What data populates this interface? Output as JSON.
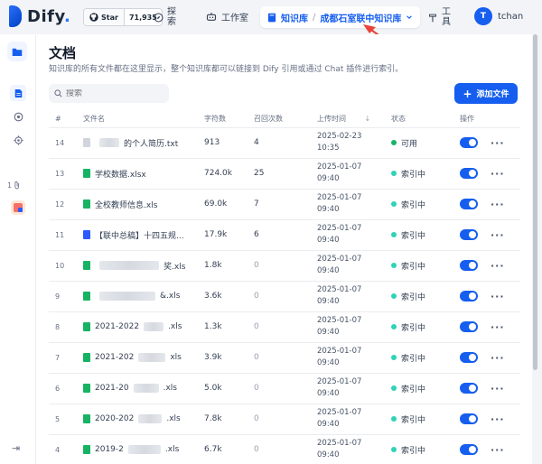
{
  "app": {
    "name": "Dify",
    "name_suffix": "."
  },
  "github": {
    "star_label": "Star",
    "star_count": "71,935"
  },
  "nav": {
    "explore": "探索",
    "studio": "工作室",
    "knowledge": "知识库",
    "dataset_name": "成都石室联中知识库",
    "tools": "工具"
  },
  "user": {
    "initial": "T",
    "name": "tchan"
  },
  "rail": {
    "attach_count": "1"
  },
  "page": {
    "title": "文档",
    "description": "知识库的所有文件都在这里显示，整个知识库都可以链接到 Dify 引用或通过 Chat 插件进行索引。",
    "search_placeholder": "搜索",
    "add_button": "添加文件"
  },
  "table": {
    "headers": {
      "index": "#",
      "name": "文件名",
      "chars": "字符数",
      "hits": "召回次数",
      "uploaded": "上传时间",
      "status": "状态",
      "actions": "操作"
    },
    "rows": [
      {
        "index": "14",
        "icon": "txt",
        "blur_w": 22,
        "prefix": "",
        "suffix": "的个人简历.txt",
        "chars": "913",
        "hits": "4",
        "date": "2025-02-23",
        "time": "10:35",
        "status": "可用",
        "status_type": "ok"
      },
      {
        "index": "13",
        "icon": "xls",
        "blur_w": 0,
        "prefix": "学校数据.xlsx",
        "suffix": "",
        "chars": "724.0k",
        "hits": "25",
        "date": "2025-01-07",
        "time": "09:40",
        "status": "索引中",
        "status_type": "idx"
      },
      {
        "index": "12",
        "icon": "xls",
        "blur_w": 0,
        "prefix": "全校教师信息.xls",
        "suffix": "",
        "chars": "69.0k",
        "hits": "7",
        "date": "2025-01-07",
        "time": "09:40",
        "status": "索引中",
        "status_type": "idx"
      },
      {
        "index": "11",
        "icon": "doc",
        "blur_w": 0,
        "prefix": "【联中总稿】十四五规...",
        "suffix": "",
        "chars": "17.9k",
        "hits": "6",
        "date": "2025-01-07",
        "time": "09:40",
        "status": "索引中",
        "status_type": "idx"
      },
      {
        "index": "10",
        "icon": "xls",
        "blur_w": 66,
        "prefix": "",
        "suffix": "奖.xls",
        "chars": "1.8k",
        "hits": "0",
        "date": "2025-01-07",
        "time": "09:40",
        "status": "索引中",
        "status_type": "idx"
      },
      {
        "index": "9",
        "icon": "xls",
        "blur_w": 62,
        "prefix": "",
        "suffix": "&.xls",
        "chars": "3.6k",
        "hits": "0",
        "date": "2025-01-07",
        "time": "09:40",
        "status": "索引中",
        "status_type": "idx"
      },
      {
        "index": "8",
        "icon": "xls",
        "blur_w": 22,
        "prefix": "2021-2022",
        "suffix": ".xls",
        "chars": "1.3k",
        "hits": "0",
        "date": "2025-01-07",
        "time": "09:40",
        "status": "索引中",
        "status_type": "idx"
      },
      {
        "index": "7",
        "icon": "xls",
        "blur_w": 30,
        "prefix": "2021-202",
        "suffix": "xls",
        "chars": "3.9k",
        "hits": "0",
        "date": "2025-01-07",
        "time": "09:40",
        "status": "索引中",
        "status_type": "idx"
      },
      {
        "index": "6",
        "icon": "xls",
        "blur_w": 28,
        "prefix": "2021-20",
        "suffix": ".xls",
        "chars": "5.0k",
        "hits": "0",
        "date": "2025-01-07",
        "time": "09:40",
        "status": "索引中",
        "status_type": "idx"
      },
      {
        "index": "5",
        "icon": "xls",
        "blur_w": 26,
        "prefix": "2020-202",
        "suffix": ".xls",
        "chars": "7.8k",
        "hits": "0",
        "date": "2025-01-07",
        "time": "09:40",
        "status": "索引中",
        "status_type": "idx"
      },
      {
        "index": "4",
        "icon": "xls",
        "blur_w": 36,
        "prefix": "2019-2",
        "suffix": ".xls",
        "chars": "6.7k",
        "hits": "0",
        "date": "2025-01-07",
        "time": "09:40",
        "status": "索引中",
        "status_type": "idx"
      }
    ]
  },
  "colors": {
    "accent": "#155eef",
    "status_ok": "#17b26a",
    "status_indexing": "#2ed3b7",
    "annotation": "#e8443a"
  }
}
